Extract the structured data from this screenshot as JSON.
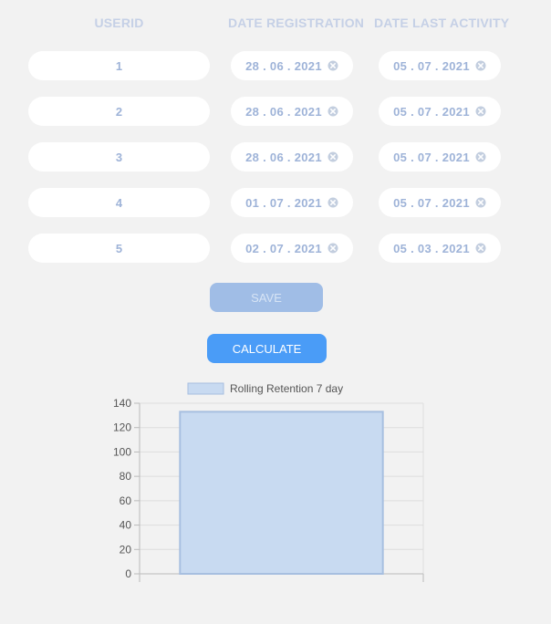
{
  "headers": {
    "userid": "USERID",
    "date_registration": "DATE REGISTRATION",
    "date_last_activity": "DATE LAST ACTIVITY"
  },
  "rows": [
    {
      "userid": "1",
      "date_registration": "28 . 06 . 2021",
      "date_last_activity": "05 . 07 . 2021"
    },
    {
      "userid": "2",
      "date_registration": "28 . 06 . 2021",
      "date_last_activity": "05 . 07 . 2021"
    },
    {
      "userid": "3",
      "date_registration": "28 . 06 . 2021",
      "date_last_activity": "05 . 07 . 2021"
    },
    {
      "userid": "4",
      "date_registration": "01 . 07 . 2021",
      "date_last_activity": "05 . 07 . 2021"
    },
    {
      "userid": "5",
      "date_registration": "02 . 07 . 2021",
      "date_last_activity": "05 . 03 . 2021"
    }
  ],
  "icons": {
    "clear": "clear-circle-x-icon"
  },
  "buttons": {
    "save": "SAVE",
    "calculate": "CALCULATE"
  },
  "colors": {
    "background": "#f2f2f2",
    "header_text": "#c5d0e6",
    "cell_text": "#9eb3d8",
    "save_disabled": "#a0bde6",
    "calculate": "#4a9cf7",
    "bar_fill": "#c8daf1",
    "bar_stroke": "#a7bfe0"
  },
  "chart_data": {
    "type": "bar",
    "categories": [
      ""
    ],
    "series": [
      {
        "name": "Rolling Retention 7 day",
        "values": [
          133
        ]
      }
    ],
    "ylim": [
      0,
      140
    ],
    "yticks": [
      0,
      20,
      40,
      60,
      80,
      100,
      120,
      140
    ],
    "grid": true,
    "legend": "top"
  }
}
